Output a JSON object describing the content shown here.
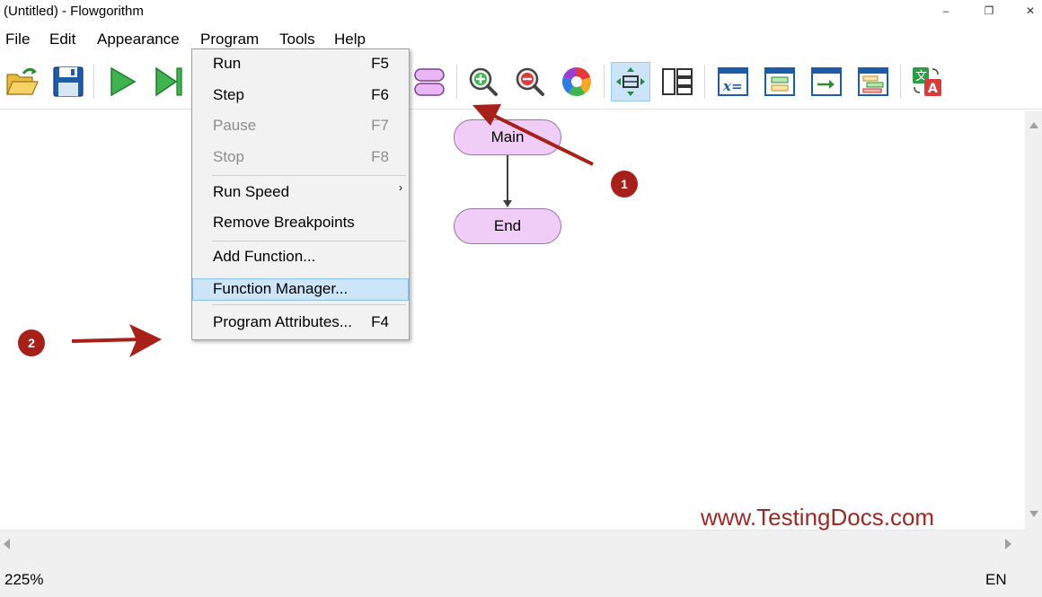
{
  "window": {
    "title": "(Untitled) - Flowgorithm",
    "minimize": "–",
    "restore": "❐",
    "close": "✕"
  },
  "menubar": {
    "file": "File",
    "edit": "Edit",
    "appearance": "Appearance",
    "program": "Program",
    "tools": "Tools",
    "help": "Help"
  },
  "program_menu": {
    "run": {
      "label": "Run",
      "key": "F5"
    },
    "step": {
      "label": "Step",
      "key": "F6"
    },
    "pause": {
      "label": "Pause",
      "key": "F7"
    },
    "stop": {
      "label": "Stop",
      "key": "F8"
    },
    "run_speed": {
      "label": "Run Speed",
      "submenu": "›"
    },
    "remove_breakpoints": {
      "label": "Remove Breakpoints"
    },
    "add_function": {
      "label": "Add Function..."
    },
    "function_manager": {
      "label": "Function Manager..."
    },
    "program_attributes": {
      "label": "Program Attributes...",
      "key": "F4"
    }
  },
  "toolbar": {
    "icons": [
      "open-icon",
      "save-icon",
      "run-icon",
      "step-icon",
      "function-manager-icon",
      "zoom-in-icon",
      "zoom-out-icon",
      "color-scheme-icon",
      "layout-flowchart-icon",
      "layout-panels-icon",
      "variable-watch-icon",
      "output-console-icon",
      "console-window-icon",
      "layout-window-icon",
      "translate-icon"
    ]
  },
  "flowchart": {
    "main_label": "Main",
    "end_label": "End",
    "node_fill": "#efcdf7"
  },
  "annotations": {
    "badge1": "1",
    "badge2": "2",
    "color": "#a8201a"
  },
  "watermark": "www.TestingDocs.com",
  "status": {
    "zoom": "225%",
    "language": "EN"
  }
}
